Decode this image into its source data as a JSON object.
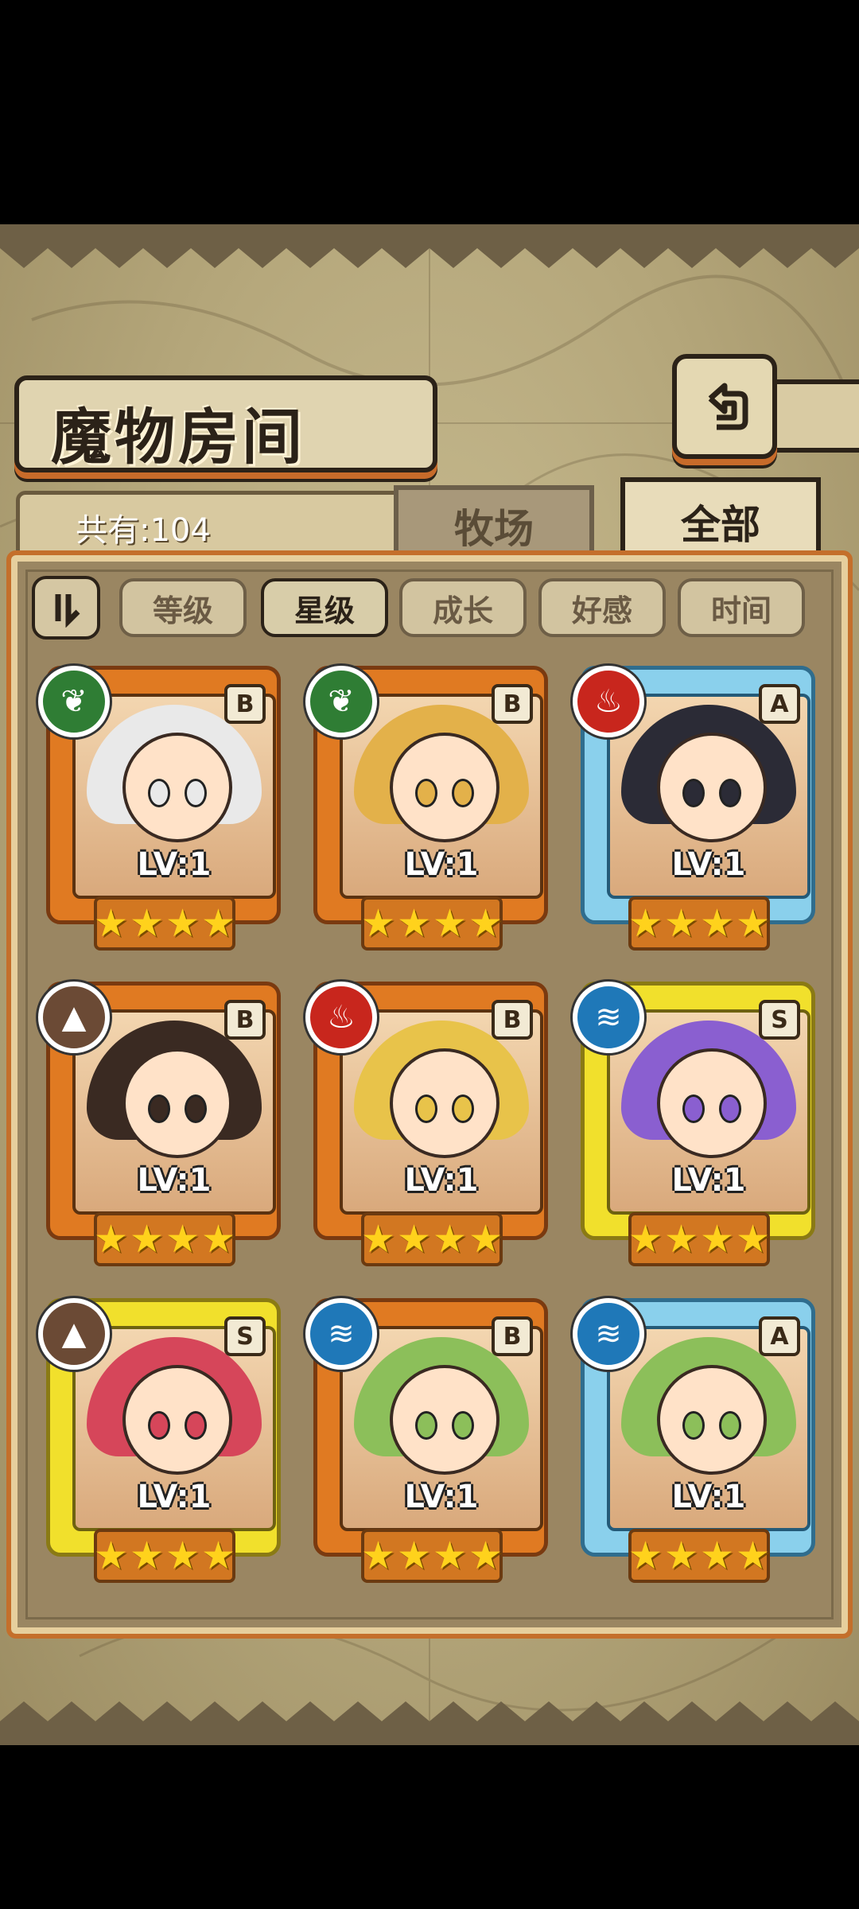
{
  "header": {
    "title": "魔物房间",
    "back_icon": "back-arrow-icon"
  },
  "summary": {
    "count_label": "共有:104"
  },
  "tabs": [
    {
      "label": "牧场",
      "active": false
    },
    {
      "label": "全部",
      "active": true
    }
  ],
  "sort": {
    "toggle_icon": "sort-order-icon",
    "options": [
      {
        "label": "等级",
        "active": false
      },
      {
        "label": "星级",
        "active": true
      },
      {
        "label": "成长",
        "active": false
      },
      {
        "label": "好感",
        "active": false
      },
      {
        "label": "时间",
        "active": false
      }
    ]
  },
  "monsters": [
    {
      "level": "LV:1",
      "rank": "B",
      "element": "wind",
      "element_color": "#2f7d34",
      "stars": 4,
      "hair": "#e9e9e9"
    },
    {
      "level": "LV:1",
      "rank": "B",
      "element": "wind",
      "element_color": "#2f7d34",
      "stars": 4,
      "hair": "#e3b14a"
    },
    {
      "level": "LV:1",
      "rank": "A",
      "element": "fire",
      "element_color": "#c8261d",
      "stars": 4,
      "hair": "#2b2b36"
    },
    {
      "level": "LV:1",
      "rank": "B",
      "element": "earth",
      "element_color": "#6b4a35",
      "stars": 4,
      "hair": "#3a2a22"
    },
    {
      "level": "LV:1",
      "rank": "B",
      "element": "fire",
      "element_color": "#c8261d",
      "stars": 4,
      "hair": "#e8c34a"
    },
    {
      "level": "LV:1",
      "rank": "S",
      "element": "water",
      "element_color": "#1f78b8",
      "stars": 4,
      "hair": "#8a5fd0"
    },
    {
      "level": "LV:1",
      "rank": "S",
      "element": "earth",
      "element_color": "#6b4a35",
      "stars": 4,
      "hair": "#d6465a"
    },
    {
      "level": "LV:1",
      "rank": "B",
      "element": "water",
      "element_color": "#1f78b8",
      "stars": 4,
      "hair": "#8cbf5a"
    },
    {
      "level": "LV:1",
      "rank": "A",
      "element": "water",
      "element_color": "#1f78b8",
      "stars": 4,
      "hair": "#8cbf5a"
    }
  ]
}
